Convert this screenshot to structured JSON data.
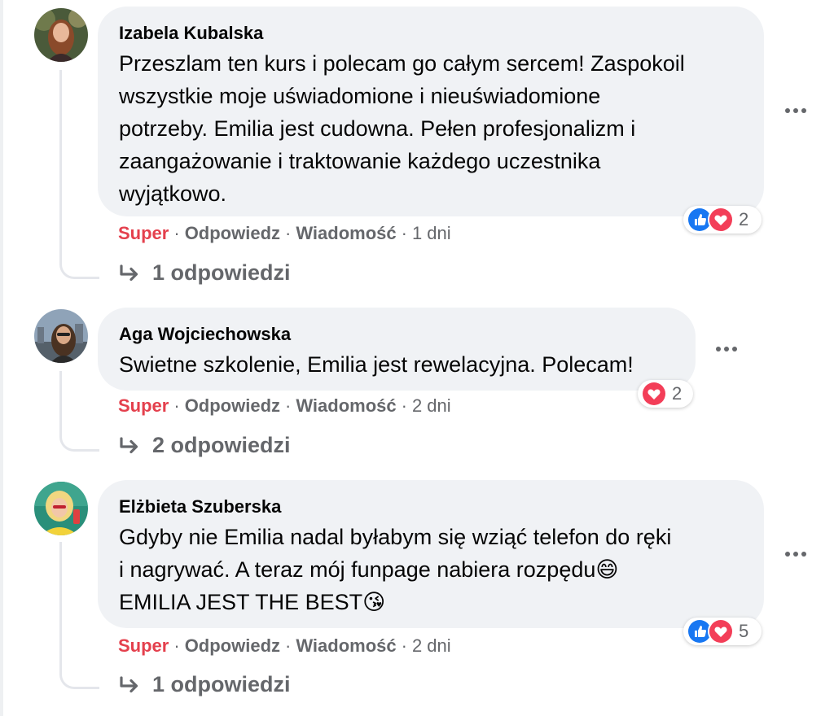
{
  "comments": [
    {
      "author": "Izabela Kubalska",
      "lines": [
        "Przeszlam ten kurs i polecam go całym sercem! Zaspokoil",
        "wszystkie moje uświadomione i nieuświadomione",
        "potrzeby. Emilia jest cudowna. Pełen profesjonalizm i",
        "zaangażowanie i traktowanie każdego uczestnika",
        "wyjątkowo."
      ],
      "reactions": [
        "like",
        "love"
      ],
      "reaction_count": "2",
      "actions": {
        "super": "Super",
        "reply": "Odpowiedz",
        "message": "Wiadomość",
        "time": "1 dni"
      },
      "replies_label": "1 odpowiedzi"
    },
    {
      "author": "Aga Wojciechowska",
      "lines": [
        "Swietne szkolenie, Emilia jest rewelacyjna. Polecam!"
      ],
      "reactions": [
        "love"
      ],
      "reaction_count": "2",
      "actions": {
        "super": "Super",
        "reply": "Odpowiedz",
        "message": "Wiadomość",
        "time": "2 dni"
      },
      "replies_label": "2 odpowiedzi"
    },
    {
      "author": "Elżbieta Szuberska",
      "lines": [
        "Gdyby nie Emilia nadal byłabym się wziąć telefon do ręki",
        "i nagrywać. A teraz mój funpage nabiera rozpędu😄",
        "EMILIA JEST THE BEST😘"
      ],
      "reactions": [
        "like",
        "love"
      ],
      "reaction_count": "5",
      "actions": {
        "super": "Super",
        "reply": "Odpowiedz",
        "message": "Wiadomość",
        "time": "2 dni"
      },
      "replies_label": "1 odpowiedzi"
    }
  ],
  "colors": {
    "super": "#e4404d",
    "bubble": "#f0f2f5",
    "meta": "#65676b",
    "like": "#1877f2",
    "love": "#f33e58"
  },
  "icons": {
    "separator": "·",
    "more": "more-options-icon",
    "reply_arrow": "reply-arrow-icon"
  }
}
